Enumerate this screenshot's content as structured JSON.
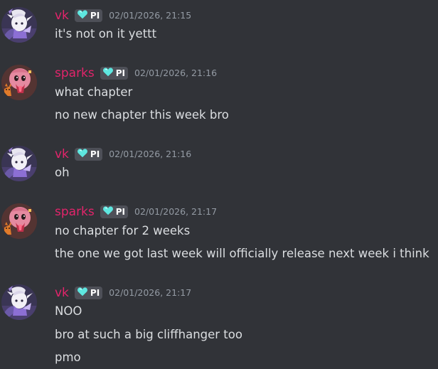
{
  "colors": {
    "background": "#313338",
    "username": "#e3246b",
    "tag_bg": "#4e5058",
    "tag_heart": "#5ee7e0",
    "timestamp": "#949ba4",
    "text": "#dbdee1"
  },
  "messages": [
    {
      "username": "vk",
      "tag": "PI",
      "tag_icon": "heart-icon",
      "timestamp": "02/01/2026, 21:15",
      "lines": [
        "it's not on it yettt"
      ]
    },
    {
      "username": "sparks",
      "tag": "PI",
      "tag_icon": "heart-icon",
      "timestamp": "02/01/2026, 21:16",
      "lines": [
        "what chapter",
        "no new chapter this week bro"
      ]
    },
    {
      "username": "vk",
      "tag": "PI",
      "tag_icon": "heart-icon",
      "timestamp": "02/01/2026, 21:16",
      "lines": [
        "oh"
      ]
    },
    {
      "username": "sparks",
      "tag": "PI",
      "tag_icon": "heart-icon",
      "timestamp": "02/01/2026, 21:17",
      "lines": [
        "no chapter for 2 weeks",
        "the one we got last week will officially release next week i think"
      ]
    },
    {
      "username": "vk",
      "tag": "PI",
      "tag_icon": "heart-icon",
      "timestamp": "02/01/2026, 21:17",
      "lines": [
        "NOO",
        "bro at such a big cliffhanger too",
        "pmo"
      ]
    }
  ]
}
